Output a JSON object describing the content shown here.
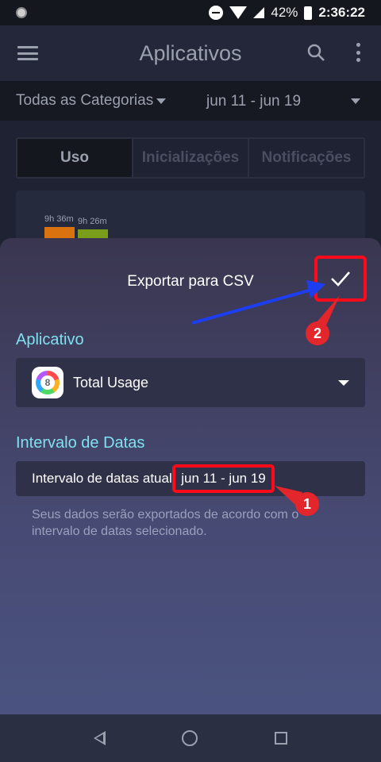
{
  "status_bar": {
    "battery": "42%",
    "time": "2:36:22"
  },
  "app_bar": {
    "title": "Aplicativos"
  },
  "filter": {
    "category": "Todas as Categorias",
    "range": "jun 11 - jun 19"
  },
  "tabs": [
    {
      "label": "Uso"
    },
    {
      "label": "Inicializações"
    },
    {
      "label": "Notificações"
    }
  ],
  "chart_card": {
    "bars": [
      {
        "label": "9h 36m",
        "color": "#d9720f"
      },
      {
        "label": "9h 26m",
        "color": "#7a9e1a"
      }
    ]
  },
  "sheet": {
    "title": "Exportar para CSV",
    "app_section_label": "Aplicativo",
    "selected_app": "Total Usage",
    "date_section_label": "Intervalo de Datas",
    "date_row_label": "Intervalo de datas atual",
    "date_range": "jun 11 - jun 19",
    "hint": "Seus dados serão exportados de acordo com o intervalo de datas selecionado."
  },
  "annotations": {
    "badge_1": "1",
    "badge_2": "2",
    "highlight_color": "#ff0a1a",
    "arrow_color": "#1d3ef0"
  }
}
